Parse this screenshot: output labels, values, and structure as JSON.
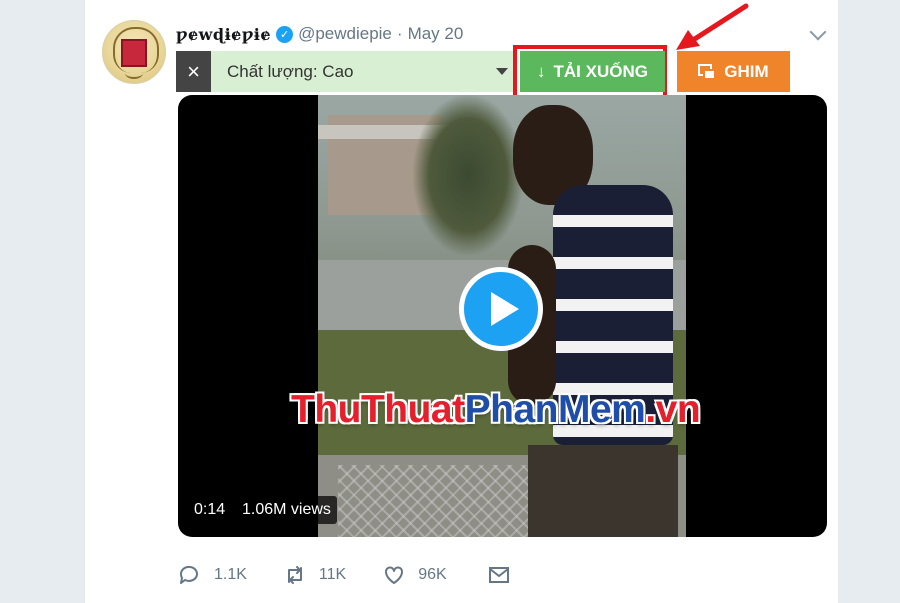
{
  "tweet": {
    "display_name": "ƿɇwɖɨɇƿɨɇ",
    "verified_mark": "✓",
    "handle": "@pewdiepie",
    "separator": "·",
    "date": "May 20"
  },
  "toolbar": {
    "close_label": "×",
    "quality_label": "Chất lượng: Cao",
    "download_arrow": "↓",
    "download_label": "TẢI XUỐNG",
    "pin_label": "GHIM"
  },
  "video": {
    "time": "0:14",
    "views": "1.06M views",
    "watermark_part1": "ThuThuat",
    "watermark_part2": "PhanMem",
    "watermark_part3": ".vn"
  },
  "actions": {
    "reply_count": "1.1K",
    "retweet_count": "11K",
    "like_count": "96K"
  },
  "colors": {
    "download_green": "#5cb85c",
    "pin_orange": "#f0842a",
    "highlight_red": "#e5181e",
    "twitter_blue": "#1da1f2"
  }
}
